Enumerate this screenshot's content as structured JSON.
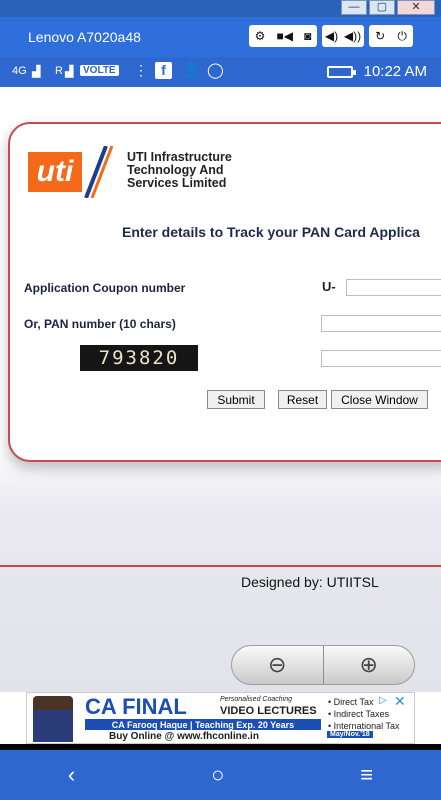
{
  "window": {
    "minimize_icon": "minimize-icon",
    "maximize_icon": "maximize-icon",
    "close_icon": "close-icon"
  },
  "emulator": {
    "device_name": "Lenovo A7020a48",
    "tool_icons_left": [
      "gear-icon",
      "video-camera-icon",
      "camera-icon"
    ],
    "tool_icons_mid": [
      "volume-down-icon",
      "volume-up-icon"
    ],
    "tool_icons_right": [
      "rotate-icon",
      "power-icon"
    ]
  },
  "statusbar": {
    "network_1": "4G",
    "network_2": "R",
    "volte": "VOLTE",
    "time": "10:22 AM"
  },
  "page": {
    "company_line1": "UTI Infrastructure",
    "company_line2": "Technology And",
    "company_line3": "Services Limited",
    "logo_text": "uti",
    "heading": "Enter details to Track your PAN Card Applica",
    "coupon_label": "Application Coupon number",
    "coupon_prefix": "U-",
    "pan_label": "Or, PAN number (10 chars)",
    "captcha_text": "793820",
    "submit_label": "Submit",
    "reset_label": "Reset",
    "close_label": "Close Window",
    "designed_by": "Designed by: UTIITSL"
  },
  "ad": {
    "title": "CA FINAL",
    "personalised": "Personalised Coaching",
    "video": "VIDEO LECTURES",
    "strip": "CA Farooq Haque | Teaching Exp. 20 Years",
    "buy": "Buy Online @ www.fhconline.in",
    "date": "May/Nov.'18",
    "bullets": [
      "• Direct Tax",
      "• Indirect Taxes",
      "• International Tax"
    ]
  },
  "accent": {
    "emulator_blue": "#2e6fdc",
    "card_border": "#c64a52",
    "uti_orange": "#f46a1a"
  }
}
